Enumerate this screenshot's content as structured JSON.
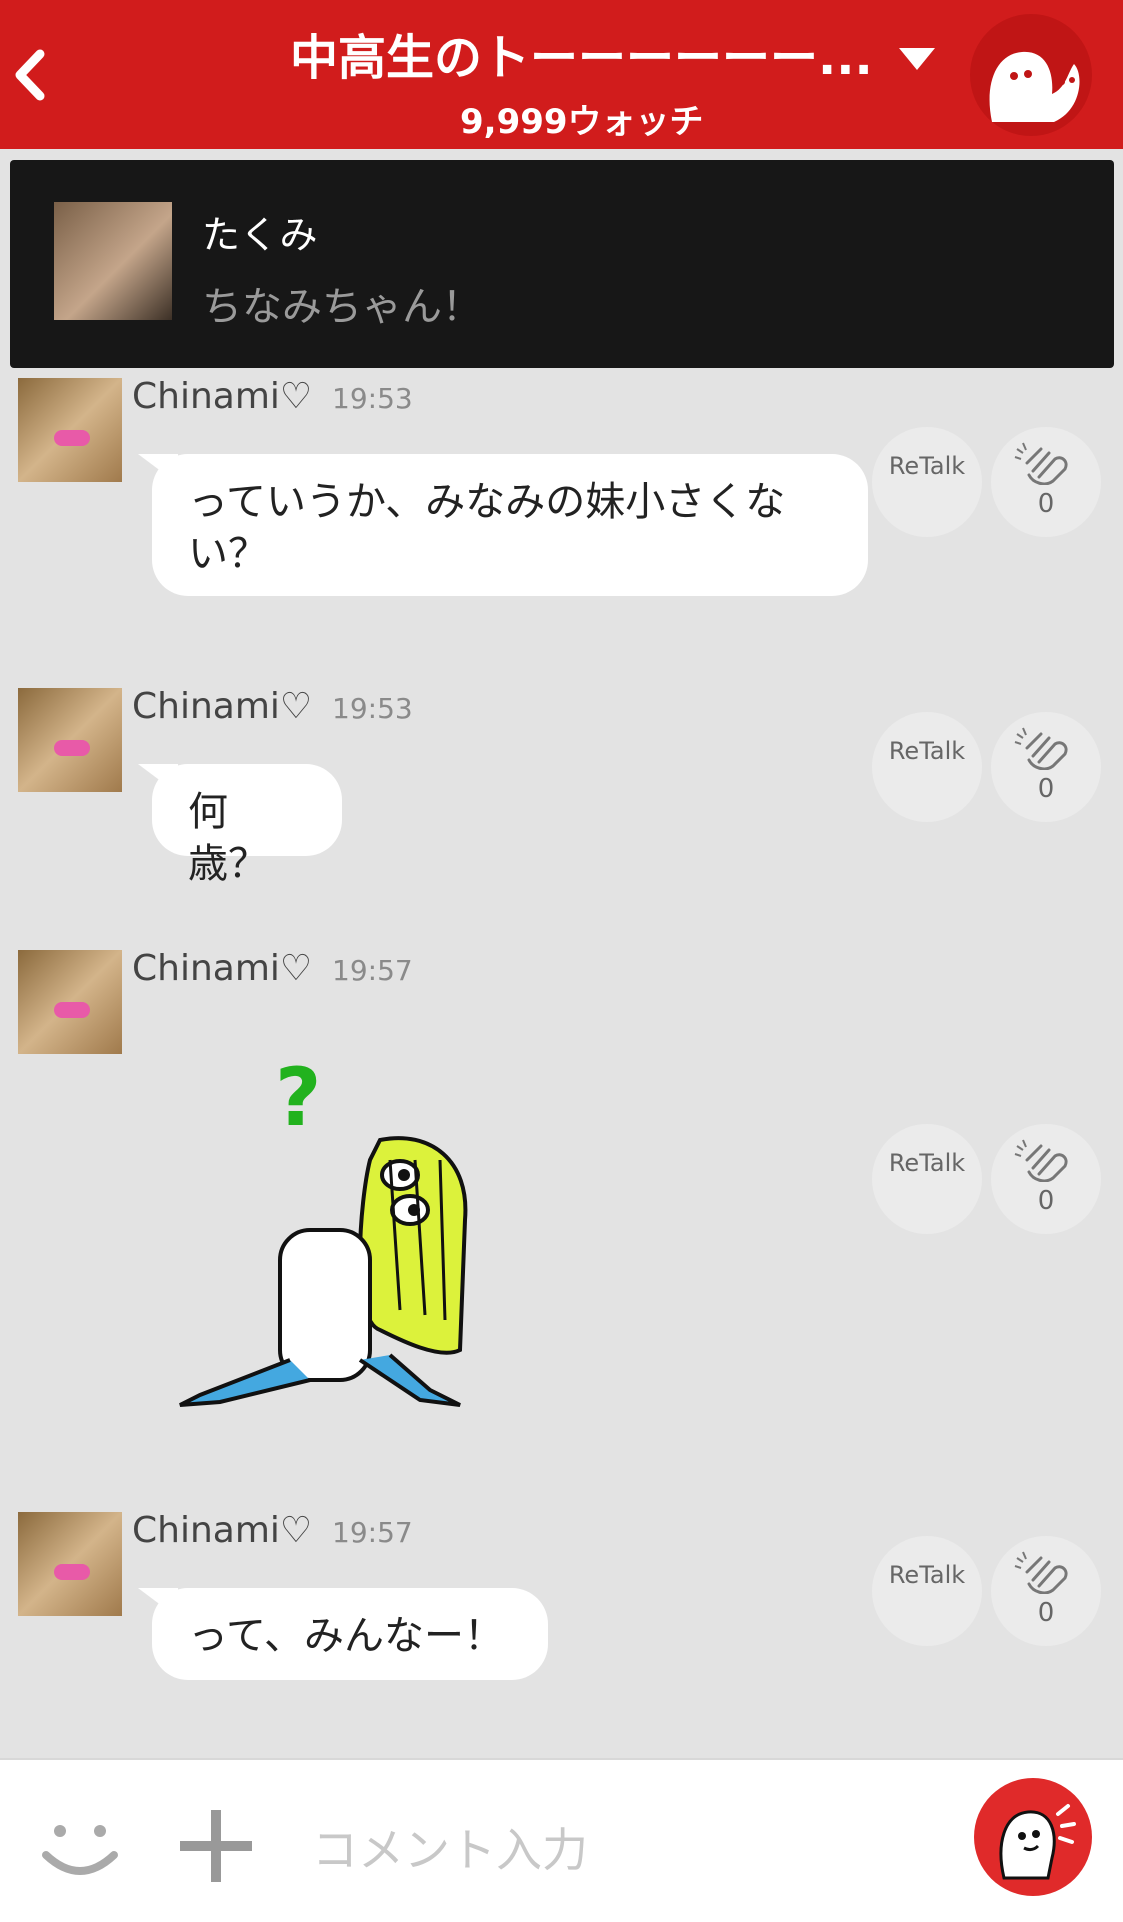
{
  "header": {
    "back_icon": "chevron-left-icon",
    "title": "中高生のトーーーーーー...",
    "watch_count": "9,999ウォッチ",
    "dropdown_icon": "triangle-down-icon",
    "room_icon": "ghost-mascot-icon"
  },
  "notification": {
    "name": "たくみ",
    "message": "ちなみちゃん！"
  },
  "messages": [
    {
      "sender": "Chinami♡",
      "time": "19:53",
      "text": "っていうか、みなみの妹小さくない？",
      "retalk": "ReTalk",
      "claps": "0"
    },
    {
      "sender": "Chinami♡",
      "time": "19:53",
      "text": "何歳？",
      "retalk": "ReTalk",
      "claps": "0"
    },
    {
      "sender": "Chinami♡",
      "time": "19:57",
      "text": "",
      "sticker": "question-character-sticker",
      "retalk": "ReTalk",
      "claps": "0"
    },
    {
      "sender": "Chinami♡",
      "time": "19:57",
      "text": "って、みんなー！",
      "retalk": "ReTalk",
      "claps": "0"
    }
  ],
  "input": {
    "placeholder": "コメント入力",
    "emoji_icon": "smile-icon",
    "add_icon": "plus-icon",
    "send_icon": "talk-mascot-icon"
  },
  "colors": {
    "header_red": "#d11c1c",
    "background": "#e3e3e3",
    "banner": "#171717",
    "send_red": "#e02a2a"
  }
}
